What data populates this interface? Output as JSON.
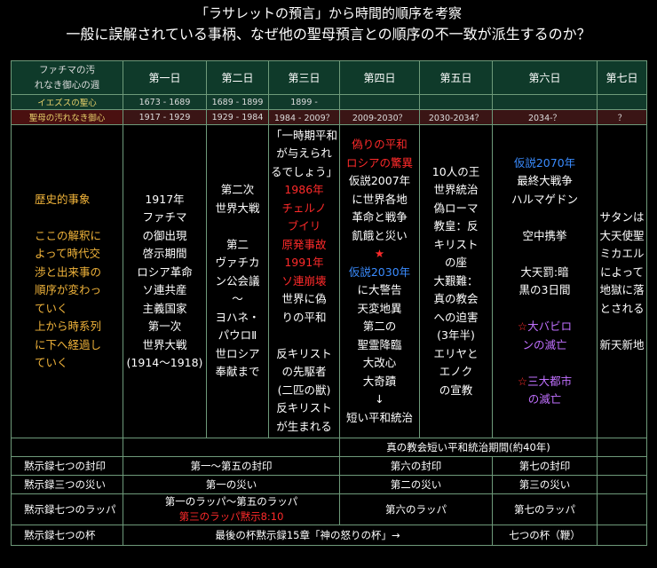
{
  "title": {
    "line1": "「ラサレットの預言」から時間的順序を考察",
    "line2": "一般に誤解されている事柄、なぜ他の聖母預言との順序の不一致が派生するのか？"
  },
  "table": {
    "corner": [
      "ファチマの汚",
      "れなき御心の週"
    ],
    "days": [
      "第一日",
      "第二日",
      "第三日",
      "第四日",
      "第五日",
      "第六日",
      "第七日"
    ],
    "jesus": {
      "label": "イエズスの聖心",
      "cells": [
        "1673 - 1689",
        "1689 - 1899",
        "1899 -",
        "",
        "",
        "",
        ""
      ]
    },
    "mary": {
      "label": "聖母の汚れなき御心",
      "cells": [
        "1917 - 1929",
        "1929 - 1984",
        "1984 - 2009？",
        "2009-2030？",
        "2030-2034？",
        "2034-？",
        "？"
      ]
    },
    "events": {
      "label_title": "歴史的事象",
      "label_body": [
        "ここの解釈に",
        "よって時代交",
        "渉と出来事の",
        "順序が変わっ",
        "ていく",
        "上から時系列",
        "に下へ経過し",
        "ていく"
      ],
      "day1": [
        "1917年",
        "ファチマ",
        "の御出現",
        "啓示期間",
        "ロシア革命",
        "ソ連共産",
        "主義国家",
        "第一次",
        "世界大戦",
        "(1914〜1918)"
      ],
      "day2": [
        "第二次",
        "世界大戦",
        "",
        "第二",
        "ヴァチカ",
        "ン公会議",
        "〜",
        "ヨハネ・",
        "パウロⅡ",
        "世ロシア",
        "奉献まで"
      ],
      "day3_a": [
        "「一時期平和",
        "が与えられ",
        "るでしょう」"
      ],
      "day3_red": [
        "1986年",
        "チェルノ",
        "ブイリ",
        "原発事故",
        "1991年",
        "ソ連崩壊"
      ],
      "day3_b": [
        "世界に偽",
        "りの平和",
        "",
        "反キリスト",
        "の先駆者",
        "(二匹の獣)",
        "反キリスト",
        "が生まれる"
      ],
      "day4_red": [
        "偽りの平和",
        "ロシアの驚異"
      ],
      "day4_a": [
        "仮説2007年",
        "に世界各地",
        "革命と戦争",
        "飢餓と災い"
      ],
      "day4_star": "★",
      "day4_blue": "仮説2030年",
      "day4_b": [
        "に大警告",
        "天変地異",
        "第二の",
        "聖霊降臨",
        "大改心",
        "大奇蹟",
        "↓",
        "短い平和統治"
      ],
      "day5": [
        "10人の王",
        "世界統治",
        "偽ローマ",
        "教皇：反",
        "キリスト",
        "の座",
        "大艱難：",
        "真の教会",
        "への迫害",
        "(3年半)",
        "エリヤと",
        "エノク",
        "の宣教"
      ],
      "day6_blue": "仮説2070年",
      "day6_a": [
        "最終大戦争",
        "ハルマゲドン",
        "",
        "空中携挙",
        "",
        "大天罰:暗",
        "黒の3日間",
        ""
      ],
      "day6_babylon_star": "☆",
      "day6_babylon": [
        "大バビロ",
        "ンの滅亡"
      ],
      "day6_cities_star": "☆",
      "day6_cities": [
        "三大都市",
        "の滅亡"
      ],
      "day7": [
        "サタンは",
        "大天使聖",
        "ミカエル",
        "によって",
        "地獄に落",
        "とされる",
        "",
        "新天新地"
      ]
    },
    "footer": {
      "peace": "真の教会短い平和統治期間(約40年)",
      "seals": {
        "label": "黙示録七つの封印",
        "a": "第一〜第五の封印",
        "b": "第六の封印",
        "c": "第七の封印"
      },
      "woes": {
        "label": "黙示録三つの災い",
        "a": "第一の災い",
        "b": "第二の災い",
        "c": "第三の災い"
      },
      "trumpets": {
        "label": "黙示録七つのラッパ",
        "a": "第一のラッパ〜第五のラッパ",
        "a_red": "第三のラッパ黙示8:10",
        "b": "第六のラッパ",
        "c": "第七のラッパ"
      },
      "bowls": {
        "label": "黙示録七つの杯",
        "a": "最後の杯黙示録15章「神の怒りの杯」→",
        "b": "七つの杯（鞭）"
      }
    }
  }
}
